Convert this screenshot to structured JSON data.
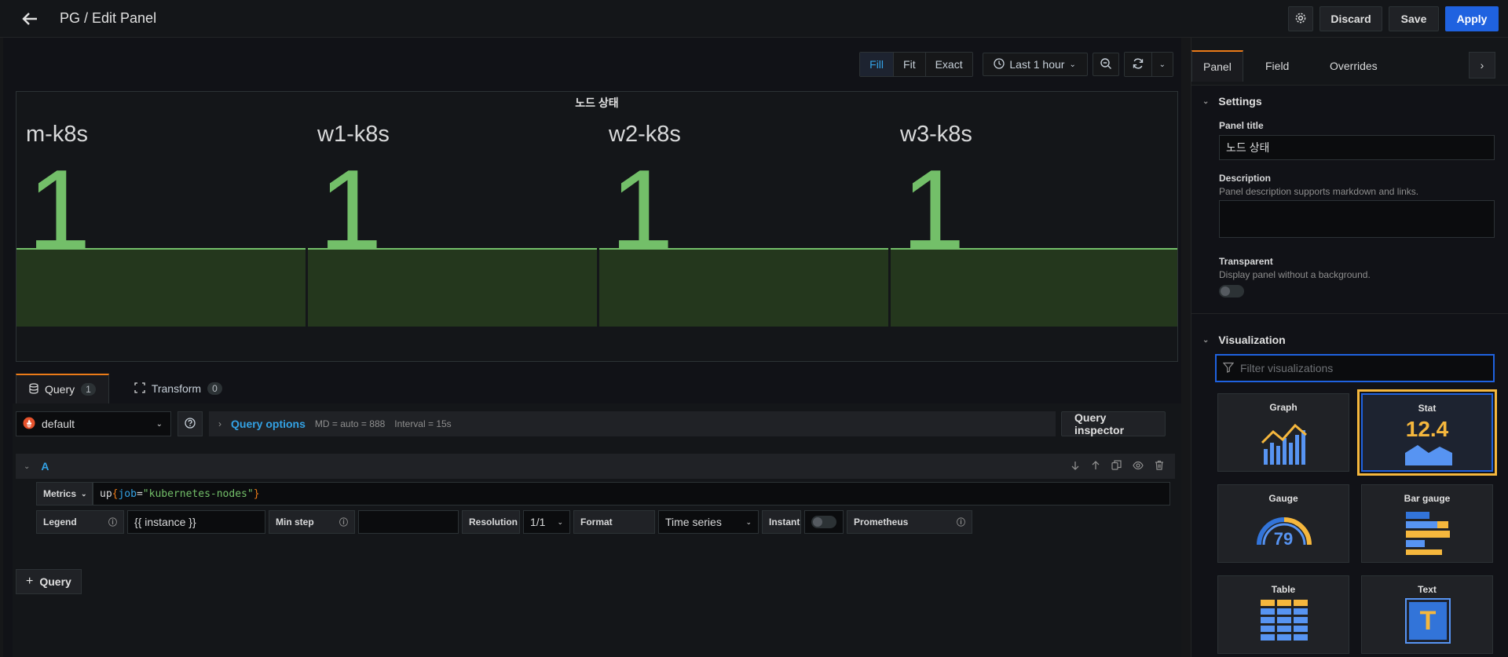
{
  "header": {
    "title": "PG / Edit Panel",
    "discard_label": "Discard",
    "save_label": "Save",
    "apply_label": "Apply"
  },
  "toolbar": {
    "modes": [
      "Fill",
      "Fit",
      "Exact"
    ],
    "active_mode": "Fill",
    "time_range": "Last 1 hour"
  },
  "panel": {
    "title": "노드 상태",
    "stats": [
      {
        "name": "m-k8s",
        "value": "1"
      },
      {
        "name": "w1-k8s",
        "value": "1"
      },
      {
        "name": "w2-k8s",
        "value": "1"
      },
      {
        "name": "w3-k8s",
        "value": "1"
      }
    ],
    "value_color": "#73bf69"
  },
  "query_tabs": [
    {
      "label": "Query",
      "count": "1"
    },
    {
      "label": "Transform",
      "count": "0"
    }
  ],
  "query": {
    "datasource": "default",
    "options_label": "Query options",
    "md": "MD = auto = 888",
    "interval": "Interval = 15s",
    "inspector_label": "Query inspector",
    "ref_id": "A",
    "metrics_label": "Metrics",
    "expr_metric": "up",
    "expr_open": "{",
    "expr_label": "job",
    "expr_eq": "=",
    "expr_value": "\"kubernetes-nodes\"",
    "expr_close": "}",
    "legend_label": "Legend",
    "legend_value": "{{ instance }}",
    "min_step_label": "Min step",
    "min_step_value": "",
    "resolution_label": "Resolution",
    "resolution_value": "1/1",
    "format_label": "Format",
    "format_value": "Time series",
    "instant_label": "Instant",
    "prometheus_label": "Prometheus",
    "add_query_label": "Query"
  },
  "sidebar": {
    "tabs": [
      "Panel",
      "Field",
      "Overrides"
    ],
    "active_tab": "Panel",
    "settings": {
      "heading": "Settings",
      "panel_title_label": "Panel title",
      "panel_title_value": "노드 상태",
      "description_label": "Description",
      "description_hint": "Panel description supports markdown and links.",
      "transparent_label": "Transparent",
      "transparent_hint": "Display panel without a background."
    },
    "visualization": {
      "heading": "Visualization",
      "filter_placeholder": "Filter visualizations",
      "items": [
        "Graph",
        "Stat",
        "Gauge",
        "Bar gauge",
        "Table",
        "Text"
      ],
      "selected": "Stat",
      "stat_sample": "12.4",
      "gauge_sample": "79",
      "text_sample": "T"
    }
  },
  "colors": {
    "accent_blue": "#1f62e0",
    "link_blue": "#33a2e5",
    "active_tab_orange": "#eb7b18",
    "selected_outline": "#f5b73d",
    "stat_green": "#73bf69"
  }
}
